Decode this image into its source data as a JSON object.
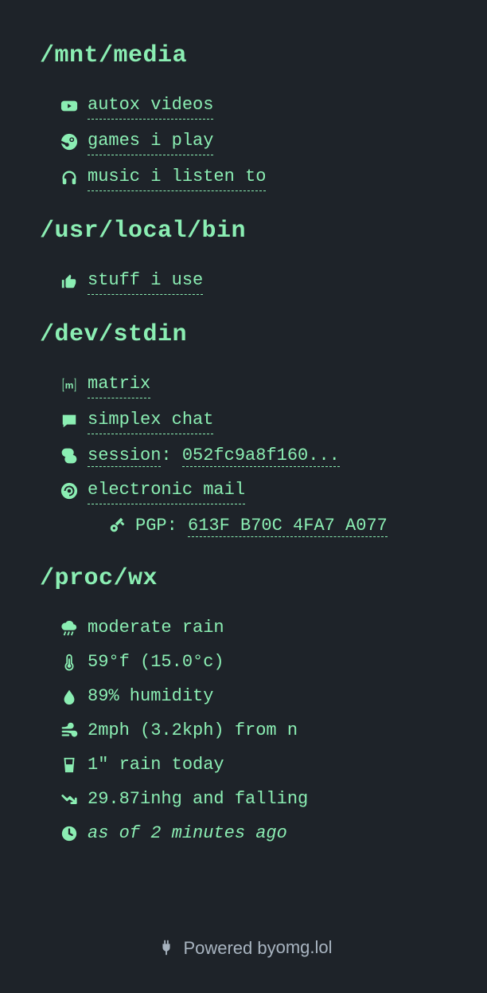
{
  "sections": {
    "media": {
      "heading": "/mnt/media",
      "items": [
        {
          "label": "autox videos"
        },
        {
          "label": "games i play"
        },
        {
          "label": "music i listen to"
        }
      ]
    },
    "bin": {
      "heading": "/usr/local/bin",
      "items": [
        {
          "label": "stuff i use"
        }
      ]
    },
    "stdin": {
      "heading": "/dev/stdin",
      "matrix": {
        "label": "matrix"
      },
      "simplex": {
        "label": "simplex chat"
      },
      "session": {
        "label": "session",
        "sep": ": ",
        "id": "052fc9a8f160..."
      },
      "mail": {
        "label": "electronic mail"
      },
      "pgp": {
        "label": "PGP: ",
        "fingerprint": "613F B70C 4FA7 A077"
      }
    },
    "wx": {
      "heading": "/proc/wx",
      "condition": "moderate rain",
      "temperature": "59°f (15.0°c)",
      "humidity": "89% humidity",
      "wind": "2mph (3.2kph) from n",
      "rain": "1\" rain today",
      "pressure": "29.87inhg and falling",
      "asof": "as of 2 minutes ago"
    }
  },
  "footer": {
    "prefix": "Powered by ",
    "link": "omg.lol"
  }
}
